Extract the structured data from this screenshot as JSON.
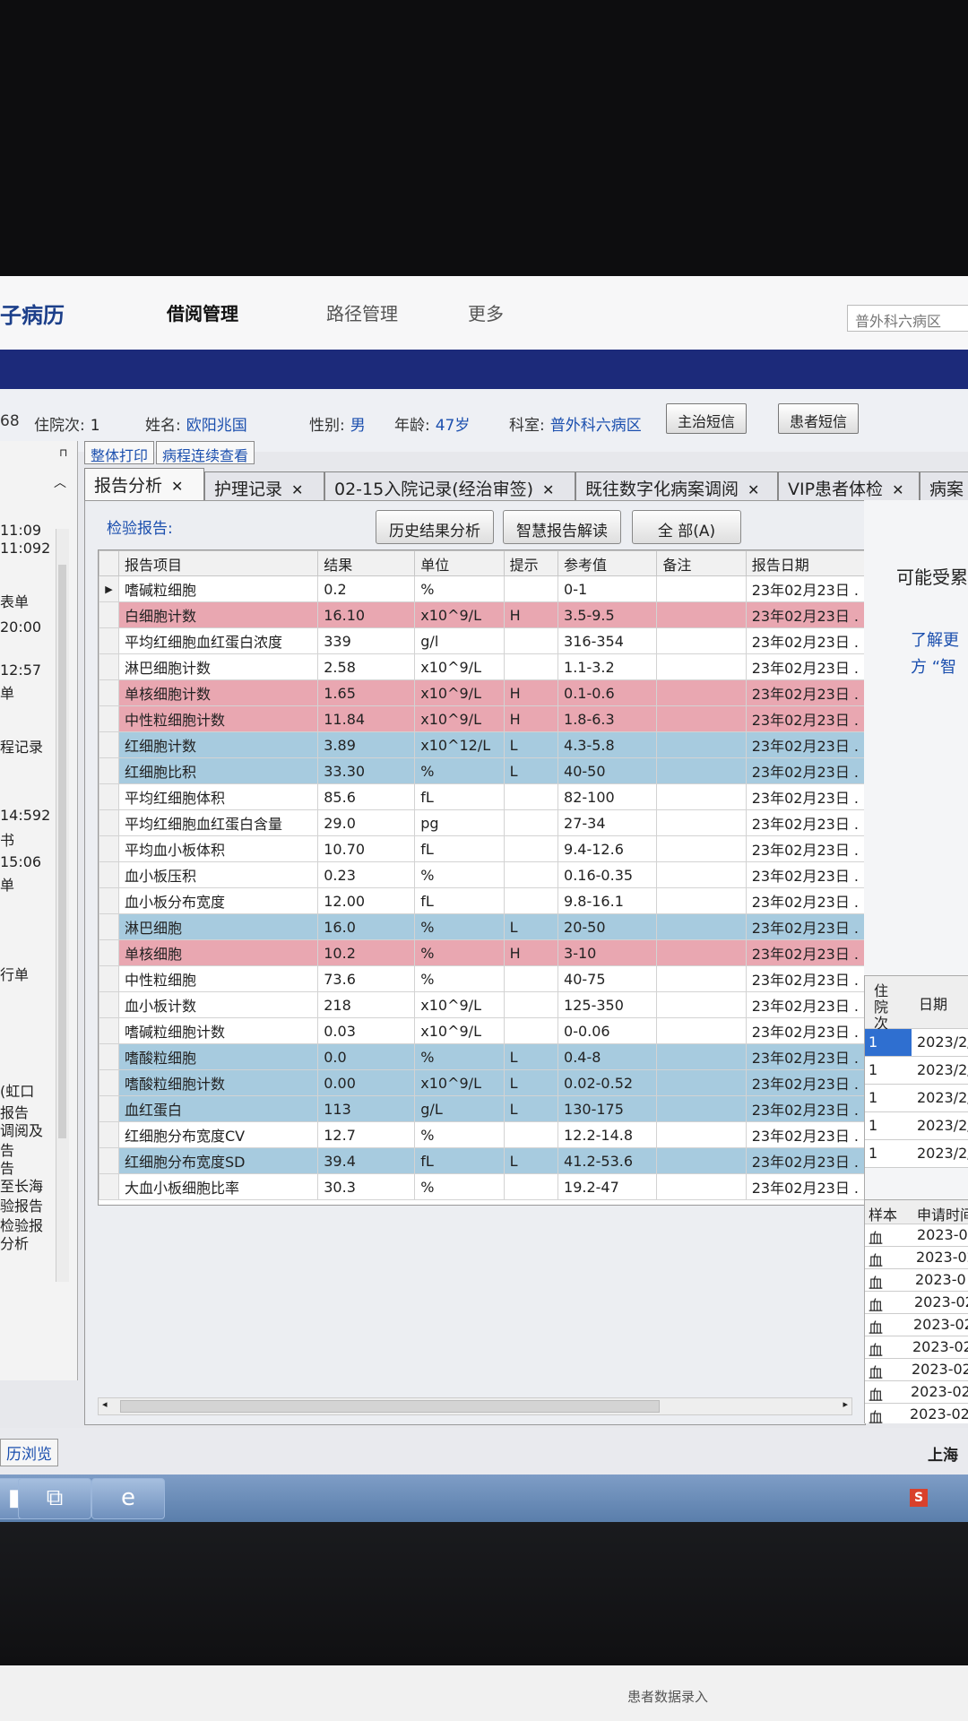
{
  "header": {
    "app_title": "子病历",
    "nav": [
      "借阅管理",
      "路径管理",
      "更多"
    ],
    "dept_select": "普外科六病区"
  },
  "patient": {
    "id_partial": "68",
    "visit_label": "住院次:",
    "visit": "1",
    "name_label": "姓名:",
    "name": "欧阳兆国",
    "gender_label": "性别:",
    "gender": "男",
    "age_label": "年龄:",
    "age": "47岁",
    "dept_label": "科室:",
    "dept": "普外科六病区",
    "btn_doctor_sms": "主治短信",
    "btn_patient_sms": "患者短信"
  },
  "left_panel": {
    "lines": [
      "11:09",
      "11:092",
      "表单",
      "20:00",
      "12:57",
      "单",
      "程记录",
      "14:592",
      "书",
      "15:06",
      "单",
      "行单",
      "(虹口",
      "报告",
      "调阅及",
      "告",
      "告",
      "至长海",
      "验报告",
      "检验报",
      "分析"
    ]
  },
  "small_tabs": [
    "整体打印",
    "病程连续查看"
  ],
  "tabs": [
    {
      "label": "报告分析",
      "closable": true
    },
    {
      "label": "护理记录",
      "closable": true
    },
    {
      "label": "02-15入院记录(经治审签)",
      "closable": true
    },
    {
      "label": "既往数字化病案调阅",
      "closable": true
    },
    {
      "label": "VIP患者体检",
      "closable": true
    },
    {
      "label": "病案",
      "closable": false
    }
  ],
  "report": {
    "label": "检验报告:",
    "btn_history": "历史结果分析",
    "btn_ai": "智慧报告解读",
    "btn_all": "全 部(A)",
    "columns": [
      "报告项目",
      "结果",
      "单位",
      "提示",
      "参考值",
      "备注",
      "报告日期"
    ],
    "rows": [
      {
        "item": "嗜碱粒细胞",
        "result": "0.2",
        "unit": "%",
        "flag": "",
        "ref": "0-1",
        "note": "",
        "date": "23年02月23日 .",
        "current": true
      },
      {
        "item": "白细胞计数",
        "result": "16.10",
        "unit": "x10^9/L",
        "flag": "H",
        "ref": "3.5-9.5",
        "note": "",
        "date": "23年02月23日 ."
      },
      {
        "item": "平均红细胞血红蛋白浓度",
        "result": "339",
        "unit": "g/l",
        "flag": "",
        "ref": "316-354",
        "note": "",
        "date": "23年02月23日 ."
      },
      {
        "item": "淋巴细胞计数",
        "result": "2.58",
        "unit": "x10^9/L",
        "flag": "",
        "ref": "1.1-3.2",
        "note": "",
        "date": "23年02月23日 ."
      },
      {
        "item": "单核细胞计数",
        "result": "1.65",
        "unit": "x10^9/L",
        "flag": "H",
        "ref": "0.1-0.6",
        "note": "",
        "date": "23年02月23日 ."
      },
      {
        "item": "中性粒细胞计数",
        "result": "11.84",
        "unit": "x10^9/L",
        "flag": "H",
        "ref": "1.8-6.3",
        "note": "",
        "date": "23年02月23日 ."
      },
      {
        "item": "红细胞计数",
        "result": "3.89",
        "unit": "x10^12/L",
        "flag": "L",
        "ref": "4.3-5.8",
        "note": "",
        "date": "23年02月23日 ."
      },
      {
        "item": "红细胞比积",
        "result": "33.30",
        "unit": "%",
        "flag": "L",
        "ref": "40-50",
        "note": "",
        "date": "23年02月23日 ."
      },
      {
        "item": "平均红细胞体积",
        "result": "85.6",
        "unit": "fL",
        "flag": "",
        "ref": "82-100",
        "note": "",
        "date": "23年02月23日 ."
      },
      {
        "item": "平均红细胞血红蛋白含量",
        "result": "29.0",
        "unit": "pg",
        "flag": "",
        "ref": "27-34",
        "note": "",
        "date": "23年02月23日 ."
      },
      {
        "item": "平均血小板体积",
        "result": "10.70",
        "unit": "fL",
        "flag": "",
        "ref": "9.4-12.6",
        "note": "",
        "date": "23年02月23日 ."
      },
      {
        "item": "血小板压积",
        "result": "0.23",
        "unit": "%",
        "flag": "",
        "ref": "0.16-0.35",
        "note": "",
        "date": "23年02月23日 ."
      },
      {
        "item": "血小板分布宽度",
        "result": "12.00",
        "unit": "fL",
        "flag": "",
        "ref": "9.8-16.1",
        "note": "",
        "date": "23年02月23日 ."
      },
      {
        "item": "淋巴细胞",
        "result": "16.0",
        "unit": "%",
        "flag": "L",
        "ref": "20-50",
        "note": "",
        "date": "23年02月23日 ."
      },
      {
        "item": "单核细胞",
        "result": "10.2",
        "unit": "%",
        "flag": "H",
        "ref": "3-10",
        "note": "",
        "date": "23年02月23日 ."
      },
      {
        "item": "中性粒细胞",
        "result": "73.6",
        "unit": "%",
        "flag": "",
        "ref": "40-75",
        "note": "",
        "date": "23年02月23日 ."
      },
      {
        "item": "血小板计数",
        "result": "218",
        "unit": "x10^9/L",
        "flag": "",
        "ref": "125-350",
        "note": "",
        "date": "23年02月23日 ."
      },
      {
        "item": "嗜碱粒细胞计数",
        "result": "0.03",
        "unit": "x10^9/L",
        "flag": "",
        "ref": "0-0.06",
        "note": "",
        "date": "23年02月23日 ."
      },
      {
        "item": "嗜酸粒细胞",
        "result": "0.0",
        "unit": "%",
        "flag": "L",
        "ref": "0.4-8",
        "note": "",
        "date": "23年02月23日 ."
      },
      {
        "item": "嗜酸粒细胞计数",
        "result": "0.00",
        "unit": "x10^9/L",
        "flag": "L",
        "ref": "0.02-0.52",
        "note": "",
        "date": "23年02月23日 ."
      },
      {
        "item": "血红蛋白",
        "result": "113",
        "unit": "g/L",
        "flag": "L",
        "ref": "130-175",
        "note": "",
        "date": "23年02月23日 ."
      },
      {
        "item": "红细胞分布宽度CV",
        "result": "12.7",
        "unit": "%",
        "flag": "",
        "ref": "12.2-14.8",
        "note": "",
        "date": "23年02月23日 ."
      },
      {
        "item": "红细胞分布宽度SD",
        "result": "39.4",
        "unit": "fL",
        "flag": "L",
        "ref": "41.2-53.6",
        "note": "",
        "date": "23年02月23日 ."
      },
      {
        "item": "大血小板细胞比率",
        "result": "30.3",
        "unit": "%",
        "flag": "",
        "ref": "19.2-47",
        "note": "",
        "date": "23年02月23日 ."
      }
    ]
  },
  "right_panel": {
    "note_title": "可能受累",
    "note_link1": "了解更",
    "note_link2": "方 “智",
    "visit_table": {
      "col_visit": "住院次",
      "col_date": "日期",
      "rows": [
        {
          "visit": "1",
          "date": "2023/2/"
        },
        {
          "visit": "1",
          "date": "2023/2/"
        },
        {
          "visit": "1",
          "date": "2023/2/"
        },
        {
          "visit": "1",
          "date": "2023/2/"
        },
        {
          "visit": "1",
          "date": "2023/2/"
        }
      ]
    },
    "sample_table": {
      "col_sample": "样本",
      "col_time": "申请时间",
      "rows": [
        {
          "sample": "血",
          "time": "2023-02"
        },
        {
          "sample": "血",
          "time": "2023-02"
        },
        {
          "sample": "血",
          "time": "2023-0"
        },
        {
          "sample": "血",
          "time": "2023-02"
        },
        {
          "sample": "血",
          "time": "2023-02"
        },
        {
          "sample": "血",
          "time": "2023-02"
        },
        {
          "sample": "血",
          "time": "2023-02"
        },
        {
          "sample": "血",
          "time": "2023-02-"
        },
        {
          "sample": "血",
          "time": "2023-02-"
        },
        {
          "sample": "血",
          "time": "2023-02-"
        },
        {
          "sample": "血",
          "time": "2023-02-"
        }
      ]
    }
  },
  "footer": {
    "tab": "历浏览",
    "right_text": "上海"
  },
  "taskbar": {
    "tray": "S"
  },
  "below_screen": {
    "caption": "患者数据录入"
  },
  "colors": {
    "high_row": "#e9a7b1",
    "low_row": "#a7cbdf",
    "accent": "#1c2a7a",
    "link": "#1b4fae"
  }
}
